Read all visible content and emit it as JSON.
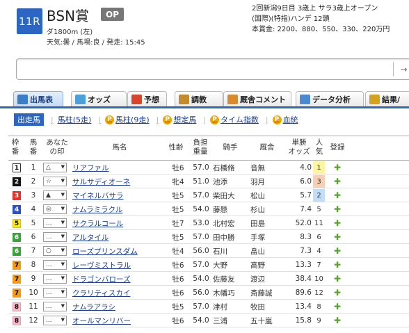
{
  "race": {
    "number": "11R",
    "name": "BSN賞",
    "grade": "OP",
    "distance": "ダ1800m (左)",
    "conditions": "天気:曇 / 馬場:良 / 発走: 15:45",
    "info_line1": "2回新潟9日目 3歳上 サラ3歳上オープン",
    "info_line2": "(国際)(特指)ハンデ 12頭",
    "info_line3": "本賞金: 2200、880、550、330、220万円"
  },
  "search": {
    "placeholder": "",
    "button_label": "→"
  },
  "tabs": [
    {
      "label": "出馬表",
      "icon": "table-icon",
      "color": "#3b7dc9"
    },
    {
      "label": "オッズ",
      "icon": "odds-icon",
      "color": "#4aa0d8"
    },
    {
      "label": "予想",
      "icon": "target-icon",
      "color": "#d9452b"
    },
    {
      "label": "調教",
      "icon": "stopwatch-icon",
      "color": "#c78a2b"
    },
    {
      "label": "厩舎コメント",
      "icon": "stable-icon",
      "color": "#d98b2b"
    },
    {
      "label": "データ分析",
      "icon": "data-icon",
      "color": "#4a8ad0"
    },
    {
      "label": "結果/",
      "icon": "trophy-icon",
      "color": "#d4a21f"
    }
  ],
  "subnav": {
    "selected": "出走馬",
    "links": [
      "馬柱(5走)",
      "馬柱(9走)",
      "想定馬",
      "タイム指数",
      "血統"
    ],
    "premium_icon_text": "P"
  },
  "headers": {
    "waku": [
      "枠",
      "番"
    ],
    "umaban": [
      "馬",
      "番"
    ],
    "mark": [
      "あなた",
      "の印"
    ],
    "horse": "馬名",
    "sexage": "性齢",
    "weight": [
      "負担",
      "重量"
    ],
    "jockey": "騎手",
    "trainer": "厩舎",
    "odds": [
      "単勝",
      "オッズ"
    ],
    "pop": [
      "人",
      "気"
    ],
    "reg": "登録"
  },
  "waku_colors": {
    "1": {
      "bg": "#ffffff",
      "fg": "#000000",
      "border": "#333333"
    },
    "2": {
      "bg": "#111111",
      "fg": "#ffffff",
      "border": "#111111"
    },
    "3": {
      "bg": "#e8322b",
      "fg": "#ffffff",
      "border": "#e8322b"
    },
    "4": {
      "bg": "#2d4fc7",
      "fg": "#ffffff",
      "border": "#2d4fc7"
    },
    "5": {
      "bg": "#ffe81a",
      "fg": "#000000",
      "border": "#d7c400"
    },
    "6": {
      "bg": "#3aa33a",
      "fg": "#ffffff",
      "border": "#3aa33a"
    },
    "7": {
      "bg": "#f39a1d",
      "fg": "#000000",
      "border": "#f39a1d"
    },
    "8": {
      "bg": "#f7b8c8",
      "fg": "#000000",
      "border": "#e79ab0"
    }
  },
  "pop_highlight": {
    "1": "#fff5a0",
    "2": "#c5dcf5",
    "3": "#f6cfb6"
  },
  "rows": [
    {
      "waku": "1",
      "umaban": "1",
      "mark": "△",
      "horse": "リアファル",
      "sexage": "牡6",
      "weight": "57.0",
      "jockey": "石橋脩",
      "trainer": "音無",
      "odds": "4.0",
      "pop": "1"
    },
    {
      "waku": "2",
      "umaban": "2",
      "mark": "☆",
      "horse": "サルサディオーネ",
      "sexage": "牝4",
      "weight": "51.0",
      "jockey": "池添",
      "trainer": "羽月",
      "odds": "6.0",
      "pop": "3"
    },
    {
      "waku": "3",
      "umaban": "3",
      "mark": "▲",
      "horse": "マイネルバサラ",
      "sexage": "牡5",
      "weight": "57.0",
      "jockey": "柴田大",
      "trainer": "松山",
      "odds": "5.7",
      "pop": "2"
    },
    {
      "waku": "4",
      "umaban": "4",
      "mark": "◎",
      "horse": "ナムラミラクル",
      "sexage": "牡5",
      "weight": "54.0",
      "jockey": "藤懸",
      "trainer": "杉山",
      "odds": "7.4",
      "pop": "5"
    },
    {
      "waku": "5",
      "umaban": "5",
      "mark": "...",
      "horse": "サクラルコール",
      "sexage": "牡7",
      "weight": "53.0",
      "jockey": "北村宏",
      "trainer": "田島",
      "odds": "52.0",
      "pop": "11"
    },
    {
      "waku": "6",
      "umaban": "6",
      "mark": "...",
      "horse": "アルタイル",
      "sexage": "牡5",
      "weight": "57.0",
      "jockey": "田中勝",
      "trainer": "手塚",
      "odds": "8.3",
      "pop": "6"
    },
    {
      "waku": "6",
      "umaban": "7",
      "mark": "○",
      "horse": "ローズプリンスダム",
      "sexage": "牡4",
      "weight": "56.0",
      "jockey": "石川",
      "trainer": "畠山",
      "odds": "7.3",
      "pop": "4"
    },
    {
      "waku": "7",
      "umaban": "8",
      "mark": "...",
      "horse": "レーヴミストラル",
      "sexage": "牡6",
      "weight": "57.0",
      "jockey": "大野",
      "trainer": "高野",
      "odds": "13.3",
      "pop": "7"
    },
    {
      "waku": "7",
      "umaban": "9",
      "mark": "...",
      "horse": "ドラゴンバローズ",
      "sexage": "牡6",
      "weight": "54.0",
      "jockey": "佐藤友",
      "trainer": "渡辺",
      "odds": "38.4",
      "pop": "10"
    },
    {
      "waku": "7",
      "umaban": "10",
      "mark": "...",
      "horse": "クラリティスカイ",
      "sexage": "牡6",
      "weight": "56.0",
      "jockey": "木幡巧",
      "trainer": "斎藤誠",
      "odds": "89.6",
      "pop": "12"
    },
    {
      "waku": "8",
      "umaban": "11",
      "mark": "...",
      "horse": "ナムラアラシ",
      "sexage": "牡5",
      "weight": "57.0",
      "jockey": "津村",
      "trainer": "牧田",
      "odds": "13.4",
      "pop": "8"
    },
    {
      "waku": "8",
      "umaban": "12",
      "mark": "...",
      "horse": "オールマンリバー",
      "sexage": "牡6",
      "weight": "54.0",
      "jockey": "三浦",
      "trainer": "五十嵐",
      "odds": "15.8",
      "pop": "9"
    }
  ]
}
